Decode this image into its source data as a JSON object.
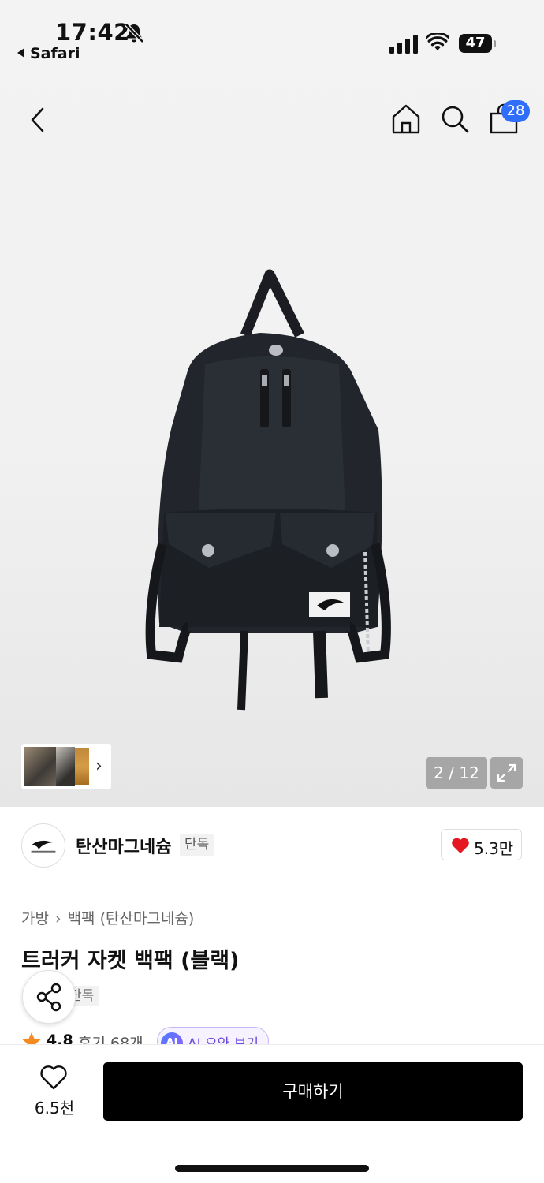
{
  "status_bar": {
    "time": "17:42",
    "back_app": "Safari",
    "battery": "47"
  },
  "nav": {
    "cart_count": "28"
  },
  "gallery": {
    "counter": "2 / 12"
  },
  "brand": {
    "name": "탄산마그네슘",
    "tag": "단독",
    "likes": "5.3만"
  },
  "product": {
    "breadcrumb": [
      "가방",
      "백팩 (탄산마그네슘)"
    ],
    "title": "트러커 자켓 백팩 (블랙)",
    "tag": "단독",
    "rating": "4.8",
    "reviews": "후기 68개",
    "ai_badge": "AI",
    "ai_summary": "AI 요약 보기"
  },
  "bottom_bar": {
    "wish_count": "6.5천",
    "buy_label": "구매하기"
  },
  "colors": {
    "badge": "#2f6dfb",
    "heart": "#e5161f",
    "star": "#f28b20",
    "ai": "#6b4bdc"
  }
}
